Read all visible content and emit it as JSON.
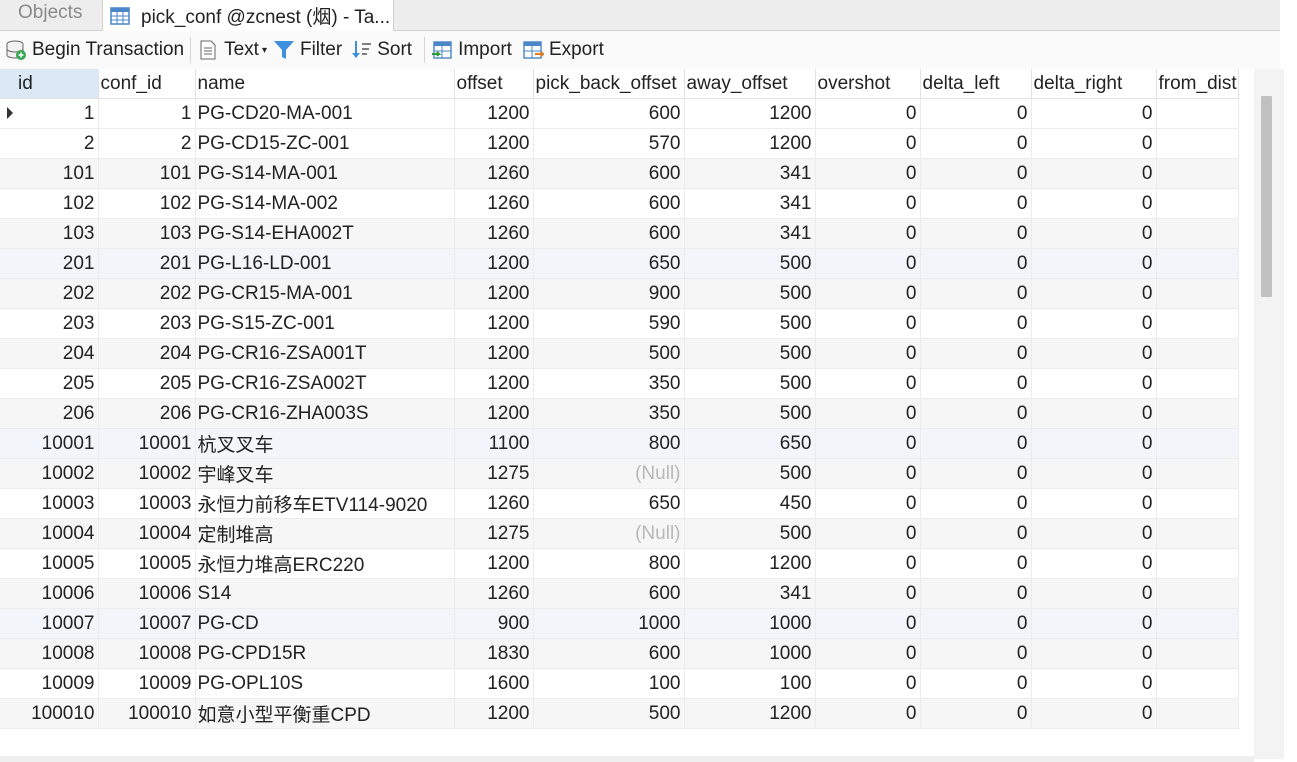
{
  "tabs": {
    "objects_label": "Objects",
    "active_label": "pick_conf @zcnest (烟) - Ta..."
  },
  "toolbar": {
    "begin_transaction": "Begin Transaction",
    "text": "Text",
    "filter": "Filter",
    "sort": "Sort",
    "import": "Import",
    "export": "Export"
  },
  "grid": {
    "columns": [
      "id",
      "conf_id",
      "name",
      "offset",
      "pick_back_offset",
      "away_offset",
      "overshot",
      "delta_left",
      "delta_right",
      "from_dist"
    ],
    "null_label": "(Null)",
    "rows": [
      [
        "1",
        "1",
        "PG-CD20-MA-001",
        "1200",
        "600",
        "1200",
        "0",
        "0",
        "0"
      ],
      [
        "2",
        "2",
        "PG-CD15-ZC-001",
        "1200",
        "570",
        "1200",
        "0",
        "0",
        "0"
      ],
      [
        "101",
        "101",
        "PG-S14-MA-001",
        "1260",
        "600",
        "341",
        "0",
        "0",
        "0"
      ],
      [
        "102",
        "102",
        "PG-S14-MA-002",
        "1260",
        "600",
        "341",
        "0",
        "0",
        "0"
      ],
      [
        "103",
        "103",
        "PG-S14-EHA002T",
        "1260",
        "600",
        "341",
        "0",
        "0",
        "0"
      ],
      [
        "201",
        "201",
        "PG-L16-LD-001",
        "1200",
        "650",
        "500",
        "0",
        "0",
        "0"
      ],
      [
        "202",
        "202",
        "PG-CR15-MA-001",
        "1200",
        "900",
        "500",
        "0",
        "0",
        "0"
      ],
      [
        "203",
        "203",
        "PG-S15-ZC-001",
        "1200",
        "590",
        "500",
        "0",
        "0",
        "0"
      ],
      [
        "204",
        "204",
        "PG-CR16-ZSA001T",
        "1200",
        "500",
        "500",
        "0",
        "0",
        "0"
      ],
      [
        "205",
        "205",
        "PG-CR16-ZSA002T",
        "1200",
        "350",
        "500",
        "0",
        "0",
        "0"
      ],
      [
        "206",
        "206",
        "PG-CR16-ZHA003S",
        "1200",
        "350",
        "500",
        "0",
        "0",
        "0"
      ],
      [
        "10001",
        "10001",
        "杭叉叉车",
        "1100",
        "800",
        "650",
        "0",
        "0",
        "0"
      ],
      [
        "10002",
        "10002",
        "宇峰叉车",
        "1275",
        null,
        "500",
        "0",
        "0",
        "0"
      ],
      [
        "10003",
        "10003",
        "永恒力前移车ETV114-9020",
        "1260",
        "650",
        "450",
        "0",
        "0",
        "0"
      ],
      [
        "10004",
        "10004",
        "定制堆高",
        "1275",
        null,
        "500",
        "0",
        "0",
        "0"
      ],
      [
        "10005",
        "10005",
        "永恒力堆高ERC220",
        "1200",
        "800",
        "1200",
        "0",
        "0",
        "0"
      ],
      [
        "10006",
        "10006",
        "S14",
        "1260",
        "600",
        "341",
        "0",
        "0",
        "0"
      ],
      [
        "10007",
        "10007",
        "PG-CD",
        "900",
        "1000",
        "1000",
        "0",
        "0",
        "0"
      ],
      [
        "10008",
        "10008",
        "PG-CPD15R",
        "1830",
        "600",
        "1000",
        "0",
        "0",
        "0"
      ],
      [
        "10009",
        "10009",
        "PG-OPL10S",
        "1600",
        "100",
        "100",
        "0",
        "0",
        "0"
      ],
      [
        "100010",
        "100010",
        "如意小型平衡重CPD",
        "1200",
        "500",
        "1200",
        "0",
        "0",
        "0"
      ]
    ]
  },
  "colors": {
    "header_selected": "#dbe9f7",
    "null_text": "#b8b8b8",
    "row_alt": "#f6f6f6",
    "row_highlight": "#f2f6fb"
  }
}
